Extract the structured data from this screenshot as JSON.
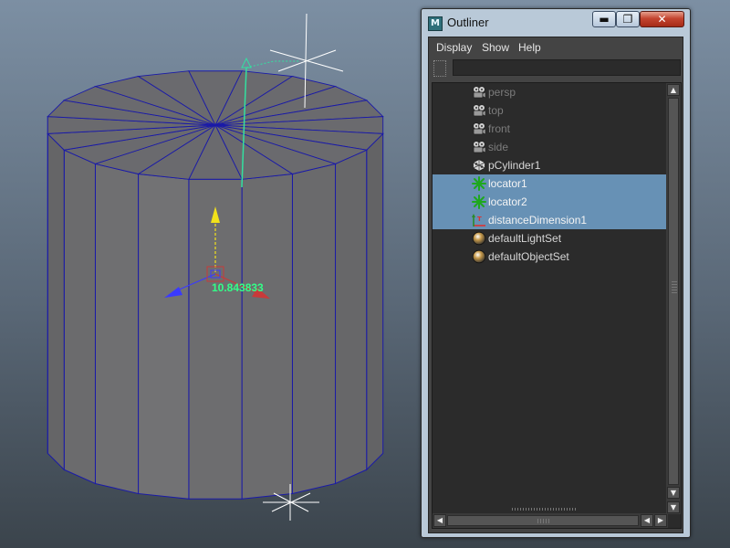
{
  "viewport": {
    "distance_readout": "10.843833"
  },
  "outliner": {
    "title": "Outliner",
    "window_buttons": {
      "minimize": "▬",
      "maximize": "❐",
      "close": "✕"
    },
    "menu": [
      "Display",
      "Show",
      "Help"
    ],
    "filter": {
      "value": "",
      "placeholder": ""
    },
    "items": [
      {
        "label": "persp",
        "icon": "camera-icon",
        "dimmed": true,
        "selected": false
      },
      {
        "label": "top",
        "icon": "camera-icon",
        "dimmed": true,
        "selected": false
      },
      {
        "label": "front",
        "icon": "camera-icon",
        "dimmed": true,
        "selected": false
      },
      {
        "label": "side",
        "icon": "camera-icon",
        "dimmed": true,
        "selected": false
      },
      {
        "label": "pCylinder1",
        "icon": "mesh-icon",
        "dimmed": false,
        "selected": false
      },
      {
        "label": "locator1",
        "icon": "locator-icon",
        "dimmed": false,
        "selected": true
      },
      {
        "label": "locator2",
        "icon": "locator-icon",
        "dimmed": false,
        "selected": true
      },
      {
        "label": "distanceDimension1",
        "icon": "distance-dimension-icon",
        "dimmed": false,
        "selected": true
      },
      {
        "label": "defaultLightSet",
        "icon": "set-icon",
        "dimmed": false,
        "selected": false
      },
      {
        "label": "defaultObjectSet",
        "icon": "set-icon",
        "dimmed": false,
        "selected": false
      }
    ]
  },
  "colors": {
    "selection": "#6791b5",
    "wireframe": "#1a1aa8",
    "measure_line": "#33e0a0",
    "readout": "#33ff88"
  }
}
